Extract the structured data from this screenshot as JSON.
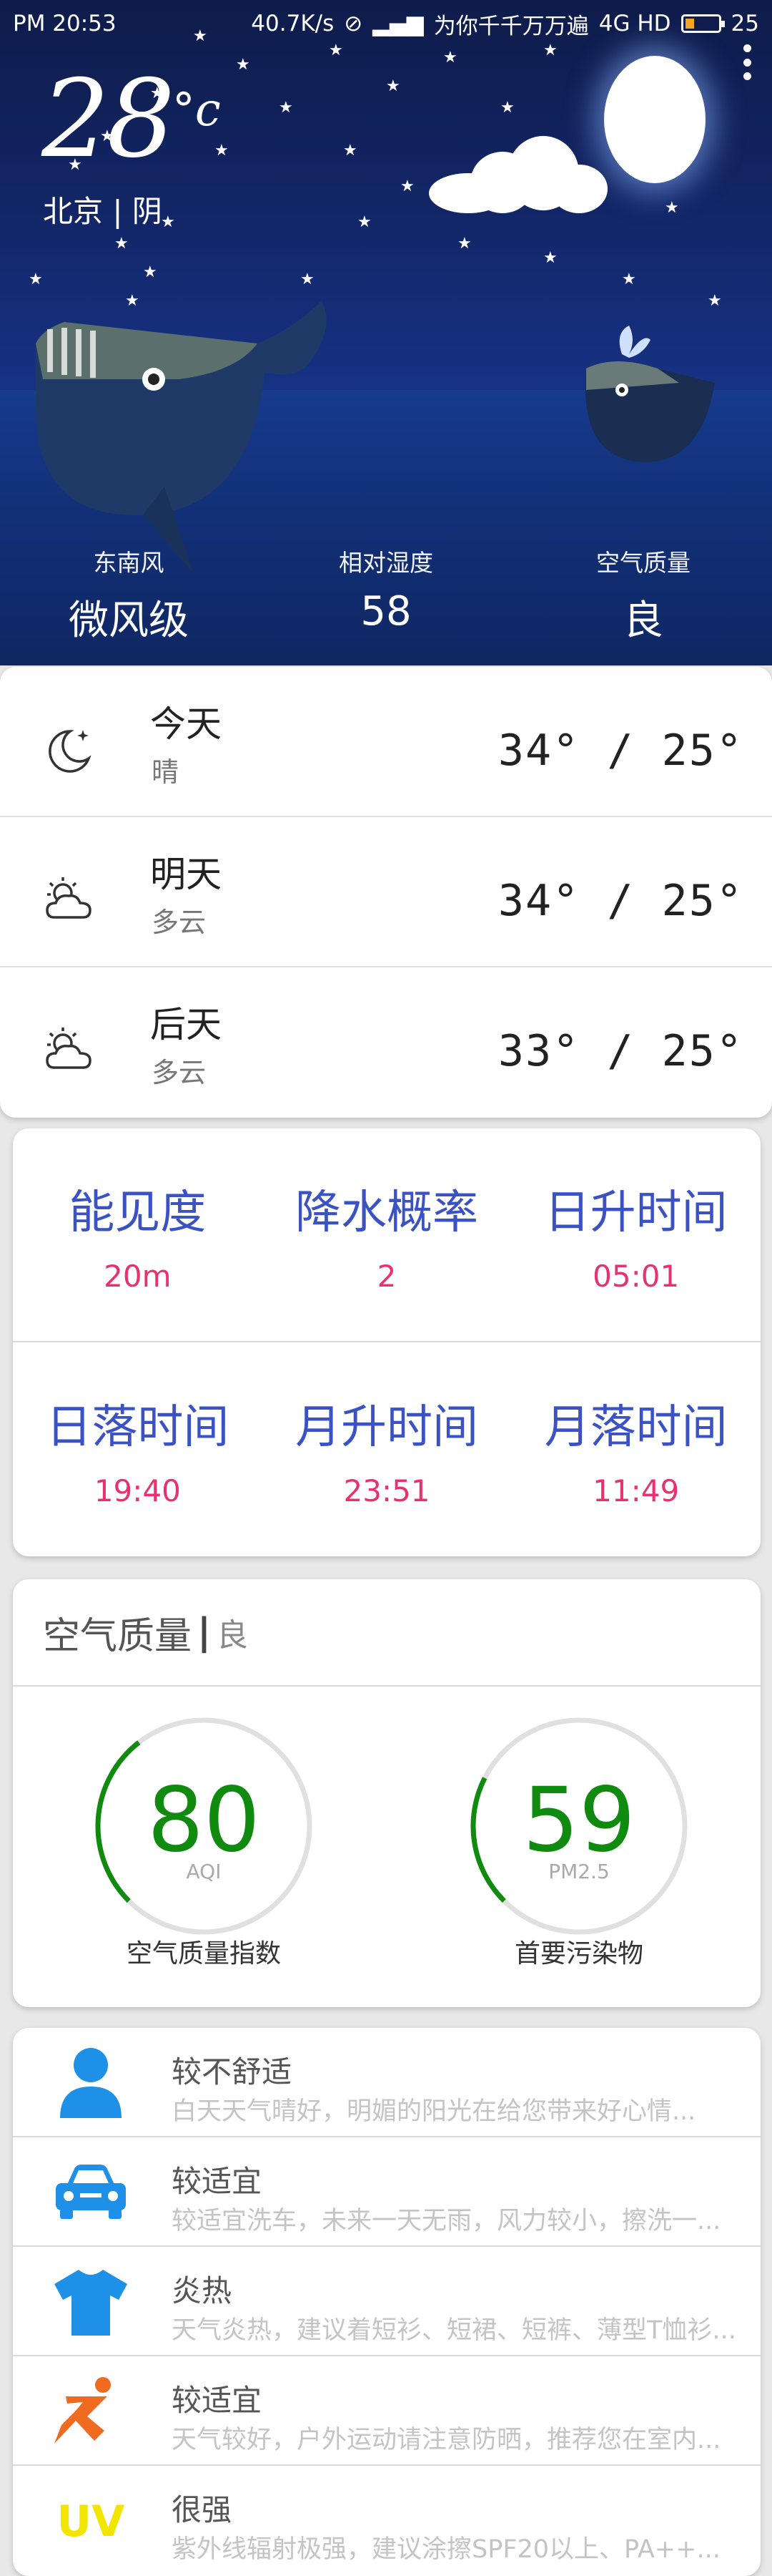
{
  "status_bar": {
    "time": "PM 20:53",
    "net_speed": "40.7K/s",
    "carrier": "为你千千万万遍",
    "network": "4G HD",
    "battery": "25"
  },
  "current": {
    "temperature": "28",
    "unit": "°c",
    "location": "北京 | 阴"
  },
  "stats": [
    {
      "label": "东南风",
      "value": "微风级"
    },
    {
      "label": "相对湿度",
      "value": "58"
    },
    {
      "label": "空气质量",
      "value": "良"
    }
  ],
  "forecast": [
    {
      "day": "今天",
      "condition": "晴",
      "temps": "34° / 25°",
      "icon": "moon-star-icon"
    },
    {
      "day": "明天",
      "condition": "多云",
      "temps": "34° / 25°",
      "icon": "partly-cloudy-icon"
    },
    {
      "day": "后天",
      "condition": "多云",
      "temps": "33° / 25°",
      "icon": "partly-cloudy-icon"
    }
  ],
  "details": [
    {
      "label": "能见度",
      "value": "20m"
    },
    {
      "label": "降水概率",
      "value": "2"
    },
    {
      "label": "日升时间",
      "value": "05:01"
    },
    {
      "label": "日落时间",
      "value": "19:40"
    },
    {
      "label": "月升时间",
      "value": "23:51"
    },
    {
      "label": "月落时间",
      "value": "11:49"
    }
  ],
  "air_quality": {
    "title": "空气质量",
    "separator": "|",
    "level": "良",
    "aqi": {
      "value": "80",
      "sub": "AQI",
      "caption": "空气质量指数",
      "fraction": 0.27
    },
    "pm25": {
      "value": "59",
      "sub": "PM2.5",
      "caption": "首要污染物",
      "fraction": 0.2
    }
  },
  "life_index": [
    {
      "icon": "person-icon",
      "title": "较不舒适",
      "desc": "白天天气晴好，明媚的阳光在给您带来好心情..."
    },
    {
      "icon": "car-icon",
      "title": "较适宜",
      "desc": "较适宜洗车，未来一天无雨，风力较小，擦洗一..."
    },
    {
      "icon": "tshirt-icon",
      "title": "炎热",
      "desc": "天气炎热，建议着短衫、短裙、短裤、薄型T恤衫..."
    },
    {
      "icon": "runner-icon",
      "title": "较适宜",
      "desc": "天气较好，户外运动请注意防晒，推荐您在室内..."
    },
    {
      "icon": "uv-icon",
      "title": "很强",
      "desc": "紫外线辐射极强，建议涂擦SPF20以上、PA++..."
    }
  ],
  "colors": {
    "detail_label": "#3a52c4",
    "detail_value": "#e8326e",
    "gauge_green": "#118a10",
    "icon_blue": "#1e90e8",
    "runner_orange": "#f06a1f",
    "uv_yellow": "#f2e600"
  }
}
